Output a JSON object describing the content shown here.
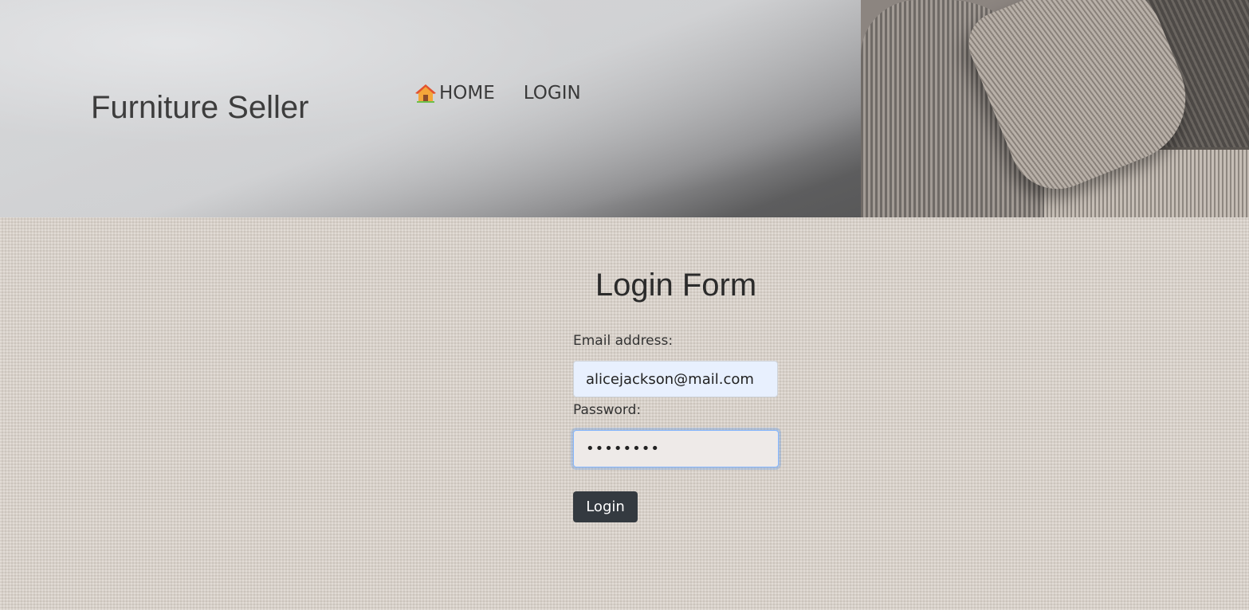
{
  "header": {
    "brand": "Furniture Seller",
    "nav": {
      "home_label": "HOME",
      "login_label": "LOGIN"
    }
  },
  "form": {
    "title": "Login Form",
    "email_label": "Email address:",
    "email_value": "alicejackson@mail.com",
    "password_label": "Password:",
    "password_value": "password",
    "submit_label": "Login"
  },
  "icons": {
    "home": "house-icon"
  },
  "colors": {
    "button_bg": "#343a40",
    "email_autofill_bg": "#e8f0fe",
    "focus_ring": "#86b7fe"
  }
}
